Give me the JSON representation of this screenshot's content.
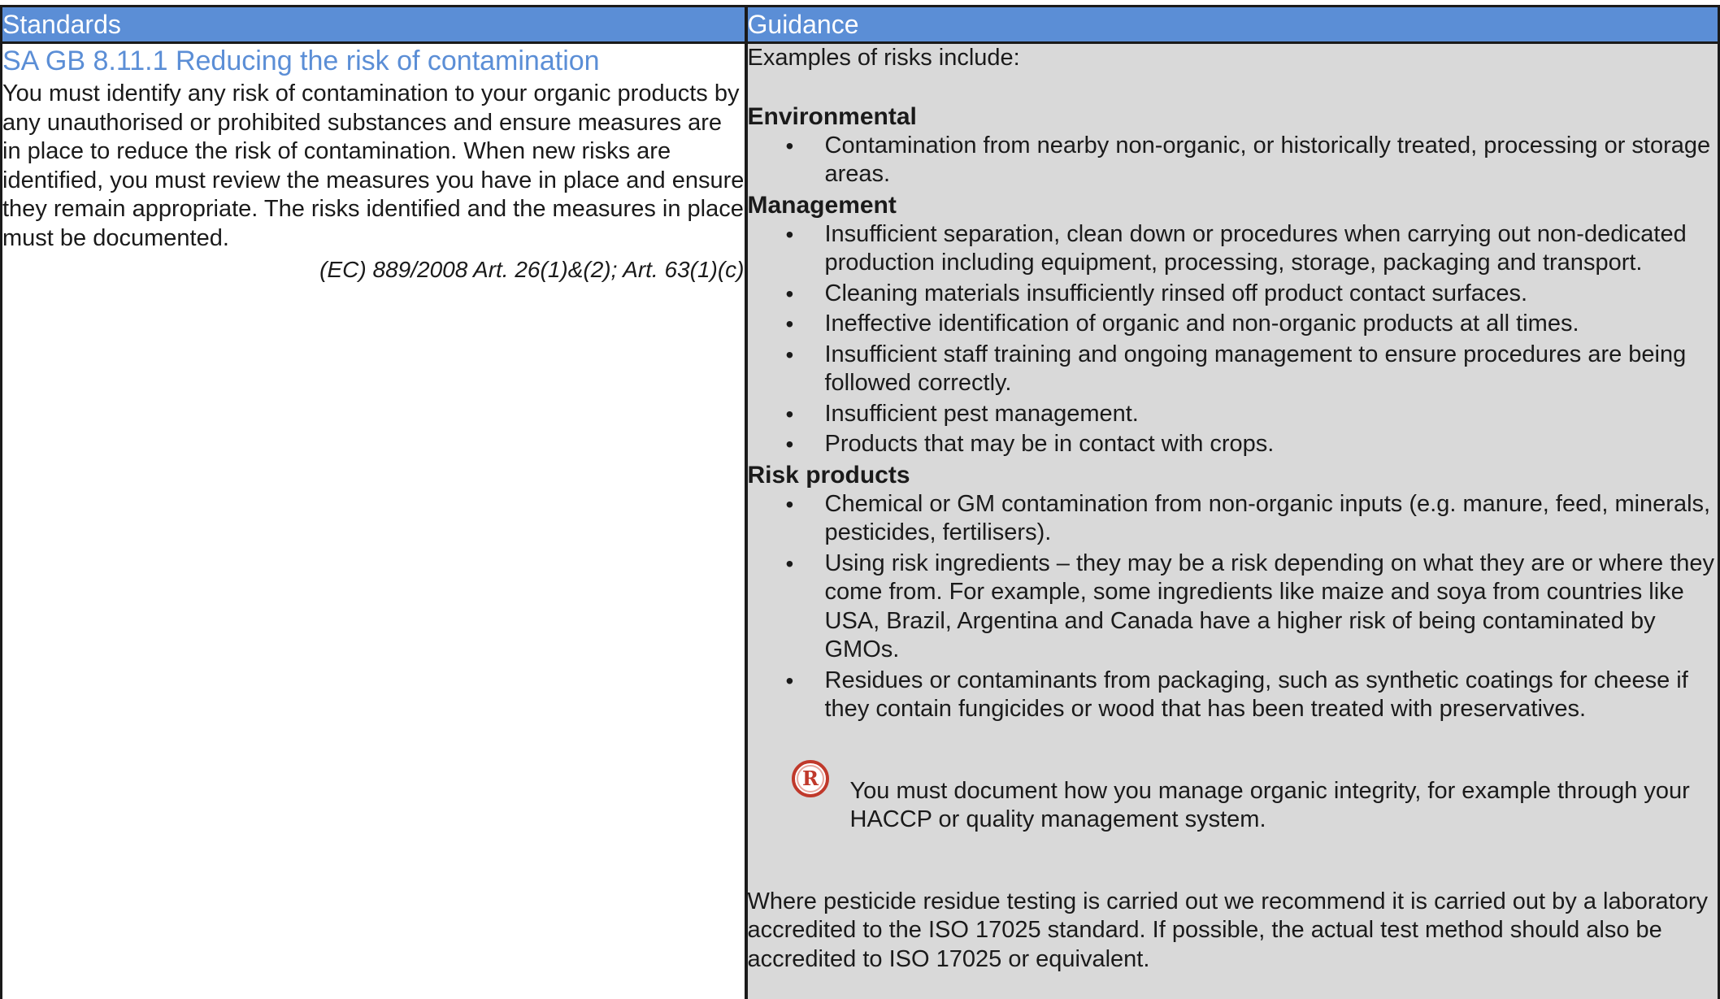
{
  "header": {
    "standards_label": "Standards",
    "guidance_label": "Guidance"
  },
  "standard": {
    "title": "SA GB 8.11.1 Reducing the risk of contamination",
    "body": "You must identify any risk of contamination to your organic products by any unauthorised or prohibited substances and ensure measures are in place to reduce the risk of contamination. When new risks are identified, you must review the measures you have in place and ensure they remain appropriate. The risks identified and the measures in place must be documented.",
    "reference": "(EC) 889/2008 Art. 26(1)&(2); Art. 63(1)(c)"
  },
  "guidance": {
    "intro": "Examples of risks include:",
    "sections": [
      {
        "heading": "Environmental",
        "items": [
          "Contamination from nearby non-organic, or historically treated, processing or storage areas."
        ]
      },
      {
        "heading": "Management",
        "items": [
          "Insufficient separation, clean down or procedures when carrying out non-dedicated production including equipment, processing, storage, packaging and transport.",
          "Cleaning materials insufficiently rinsed off product contact surfaces.",
          "Ineffective identification of organic and non-organic products at all times.",
          "Insufficient staff training and ongoing management to ensure procedures are being followed correctly.",
          "Insufficient pest management.",
          "Products that may be in contact with crops."
        ]
      },
      {
        "heading": "Risk products",
        "items": [
          "Chemical or GM contamination from non-organic inputs (e.g. manure, feed, minerals, pesticides, fertilisers).",
          "Using risk ingredients – they may be a risk depending on what they are or where they come from. For example, some ingredients like maize and soya from countries like USA, Brazil, Argentina and Canada have a higher risk of being contaminated by GMOs.",
          "Residues or contaminants from packaging, such as synthetic coatings for cheese if they contain fungicides or wood that has been treated with preservatives."
        ]
      }
    ],
    "record_note": {
      "icon": "record-icon",
      "icon_letter": "R",
      "icon_color": "#c0392b",
      "text": "You must document how you manage organic integrity, for example through your HACCP or quality management system."
    },
    "closing": "Where pesticide residue testing is carried out we recommend it is carried out by a laboratory accredited to the ISO 17025 standard. If possible, the actual test method should also be accredited to ISO 17025 or equivalent."
  },
  "colors": {
    "header_bg": "#5b8ed6",
    "guidance_bg": "#d9d9d9",
    "title_color": "#5b8ed6"
  }
}
